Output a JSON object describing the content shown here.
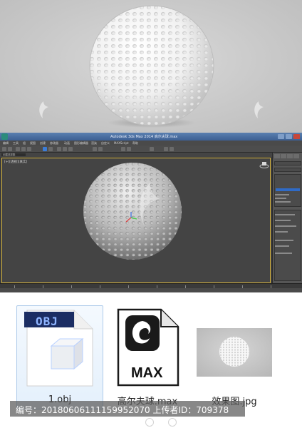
{
  "render_preview": {
    "subject": "golf-ball-render"
  },
  "max_window": {
    "title": "Autodesk 3ds Max  2014  高尔夫球.max",
    "menu_items": [
      "编辑",
      "工具",
      "组",
      "视图",
      "创建",
      "修改器",
      "动画",
      "图形编辑器",
      "渲染",
      "自定义",
      "MAXScript",
      "帮助"
    ],
    "selection_set": "创建选择集",
    "viewport_label": "[+][透视][真实]",
    "accent_color": "#d8b640",
    "highlight_color": "#2f6bc7"
  },
  "files": [
    {
      "name": "1.obj",
      "badge": "OBJ",
      "icon": "obj-file-icon"
    },
    {
      "name": "高尔夫球.max",
      "badge": "MAX",
      "icon": "max-file-icon"
    },
    {
      "name": "效果图.jpg",
      "icon": "jpg-thumbnail-icon"
    }
  ],
  "caption": {
    "text": "编号：20180606111159952070 上传者ID：709378"
  }
}
